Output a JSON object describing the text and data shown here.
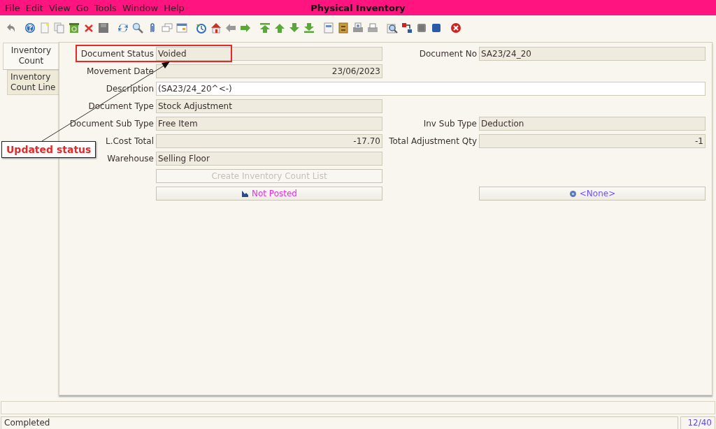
{
  "window": {
    "title": "Physical Inventory"
  },
  "menu": [
    {
      "label": "File"
    },
    {
      "label": "Edit"
    },
    {
      "label": "View"
    },
    {
      "label": "Go"
    },
    {
      "label": "Tools"
    },
    {
      "label": "Window"
    },
    {
      "label": "Help"
    }
  ],
  "tabs": [
    {
      "label": "Inventory Count",
      "selected": true
    },
    {
      "label": "Inventory Count Line",
      "selected": false
    }
  ],
  "form": {
    "rows": [
      {
        "left": {
          "kind": "text",
          "label": "Document Status",
          "value": "Voided"
        },
        "right": {
          "kind": "text",
          "label": "Document No",
          "value": "SA23/24_20"
        }
      },
      {
        "left": {
          "kind": "number",
          "label": "Movement Date",
          "value": "23/06/2023"
        }
      },
      {
        "left": {
          "kind": "wide-input",
          "label": "Description",
          "value": "(SA23/24_20^<-)"
        }
      },
      {
        "left": {
          "kind": "text",
          "label": "Document Type",
          "value": "Stock Adjustment"
        }
      },
      {
        "left": {
          "kind": "text",
          "label": "Document Sub Type",
          "value": "Free Item"
        },
        "right": {
          "kind": "text",
          "label": "Inv Sub Type",
          "value": "Deduction"
        }
      },
      {
        "left": {
          "kind": "number",
          "label": "L.Cost Total",
          "value": "-17.70"
        },
        "right": {
          "kind": "number",
          "label": "Total Adjustment Qty",
          "value": "-1"
        }
      },
      {
        "left": {
          "kind": "text",
          "label": "Warehouse",
          "value": "Selling Floor"
        }
      },
      {
        "left": {
          "kind": "button",
          "value": "Create Inventory Count List",
          "disabled": true
        }
      },
      {
        "left": {
          "kind": "posting",
          "value": "Not Posted",
          "disabled": false
        },
        "right": {
          "kind": "workflow",
          "value": "<None>",
          "disabled": false
        }
      }
    ]
  },
  "annotation": {
    "text": "Updated status"
  },
  "status_bar": {
    "message": "Completed",
    "record": "12/40"
  }
}
